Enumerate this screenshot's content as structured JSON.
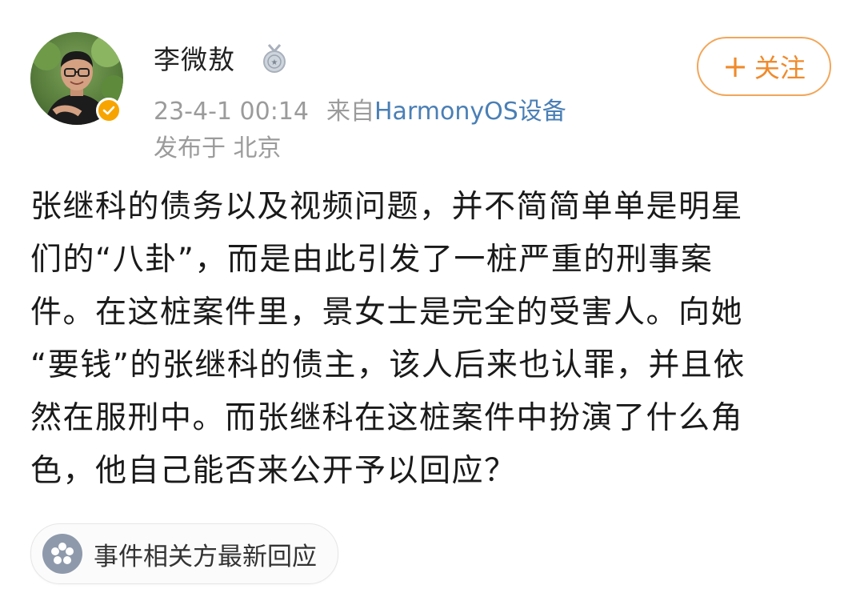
{
  "header": {
    "user_name": "李微敖",
    "medal_icon": "medal-icon",
    "verified_icon": "verified-check-icon",
    "timestamp": "23-4-1 00:14",
    "source_prefix": "来自",
    "source_device": "HarmonyOS设备",
    "location": "发布于 北京",
    "follow_button": "关注"
  },
  "content": {
    "lines": [
      "张继科的债务以及视频问题，并不简简单单是明星",
      "们的“八卦”，而是由此引发了一桩严重的刑事案",
      "件。在这桩案件里，景女士是完全的受害人。向她",
      "“要钱”的张继科的债主，该人后来也认罪，并且依",
      "然在服刑中。而张继科在这桩案件中扮演了什么角",
      "色，他自己能否来公开予以回应？"
    ]
  },
  "topic": {
    "icon": "flower-icon",
    "label": "事件相关方最新回应"
  },
  "colors": {
    "follow": "#f08a2b",
    "source_link": "#4a7fb5",
    "verified": "#f7a400",
    "meta_gray": "#9b9b9b"
  }
}
